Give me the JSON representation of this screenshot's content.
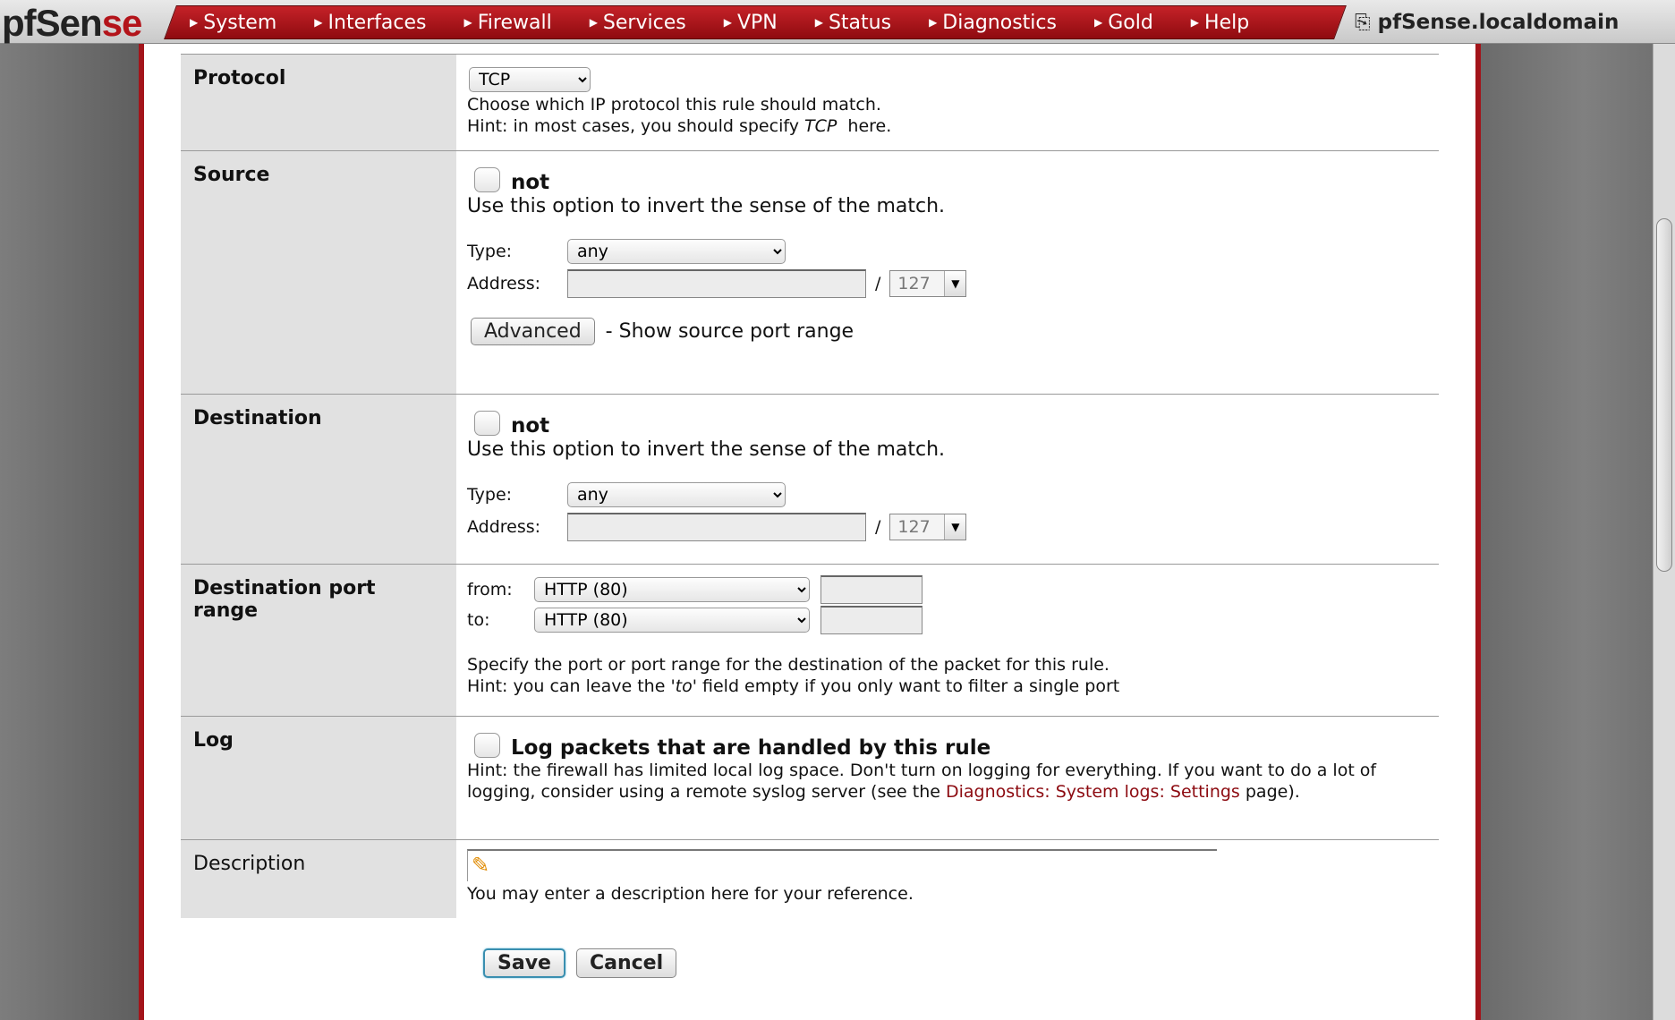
{
  "brand": {
    "logo_prefix": "pf",
    "logo_main": "Sen",
    "logo_accent": "se"
  },
  "nav": {
    "items": [
      "System",
      "Interfaces",
      "Firewall",
      "Services",
      "VPN",
      "Status",
      "Diagnostics",
      "Gold",
      "Help"
    ],
    "hostname": "pfSense.localdomain"
  },
  "form": {
    "protocol": {
      "label": "Protocol",
      "selected": "TCP",
      "hint1": "Choose which IP protocol this rule should match.",
      "hint2_pre": "Hint: in most cases, you should specify ",
      "hint2_em": "TCP",
      "hint2_post": "  here."
    },
    "source": {
      "label": "Source",
      "not_label": "not",
      "invert_hint": "Use this option to invert the sense of the match.",
      "type_label": "Type:",
      "type_selected": "any",
      "address_label": "Address:",
      "address_value": "",
      "slash": "/",
      "mask": "127",
      "advanced_button": "Advanced",
      "advanced_hint": "- Show source port range"
    },
    "destination": {
      "label": "Destination",
      "not_label": "not",
      "invert_hint": "Use this option to invert the sense of the match.",
      "type_label": "Type:",
      "type_selected": "any",
      "address_label": "Address:",
      "address_value": "",
      "slash": "/",
      "mask": "127"
    },
    "dest_port": {
      "label": "Destination port range",
      "from_label": "from:",
      "from_selected": "HTTP (80)",
      "from_custom": "",
      "to_label": "to:",
      "to_selected": "HTTP (80)",
      "to_custom": "",
      "hint1": "Specify the port or port range for the destination of the packet for this rule.",
      "hint2_pre": "Hint: you can leave the ",
      "hint2_em": "'to'",
      "hint2_post": " field empty if you only want to filter a single port"
    },
    "log": {
      "label": "Log",
      "checkbox_label": "Log packets that are handled by this rule",
      "hint_pre": "Hint: the firewall has limited local log space. Don't turn on logging for everything. If you want to do a lot of logging, consider using a remote syslog server (see the ",
      "hint_link": "Diagnostics: System logs: Settings",
      "hint_post": " page)."
    },
    "description": {
      "label": "Description",
      "value": "",
      "hint": "You may enter a description here for your reference."
    },
    "buttons": {
      "save": "Save",
      "cancel": "Cancel"
    }
  },
  "colors": {
    "accent_red": "#a3141a",
    "label_bg": "#e1e1e1",
    "link": "#8c0a10"
  }
}
